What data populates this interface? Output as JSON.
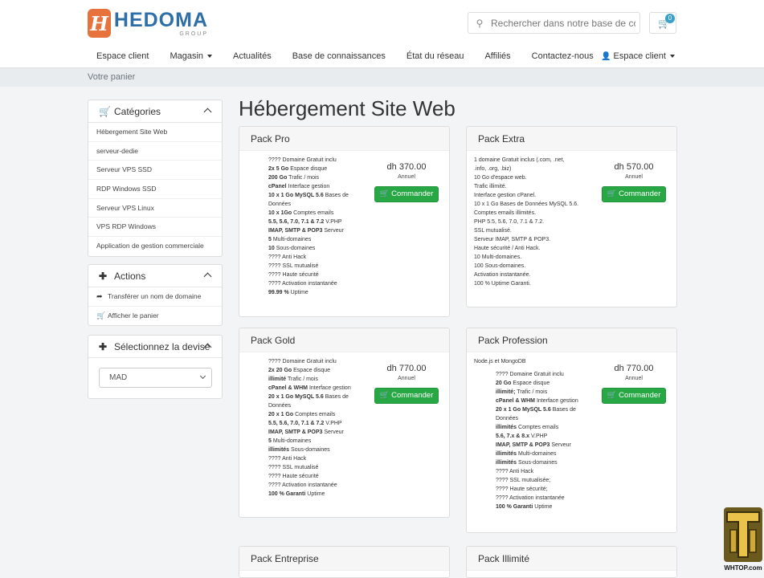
{
  "brand": {
    "badge": "H",
    "name": "HEDOMA",
    "sub": "GROUP",
    "color": "#e8723c"
  },
  "search": {
    "placeholder": "Rechercher dans notre base de connaissances"
  },
  "cart": {
    "count": "0"
  },
  "nav": {
    "items": [
      "Espace client",
      "Magasin",
      "Actualités",
      "Base de connaissances",
      "État du réseau",
      "Affiliés",
      "Contactez-nous"
    ],
    "account": "Espace client"
  },
  "breadcrumb": "Votre panier",
  "sidebar": {
    "categories": {
      "title": "Catégories",
      "items": [
        "Hébergement Site Web",
        "serveur-dedie",
        "Serveur VPS SSD",
        "RDP Windows SSD",
        "Serveur VPS Linux",
        "VPS RDP Windows",
        "Application de gestion commerciale"
      ]
    },
    "actions": {
      "title": "Actions",
      "items": [
        "Transférer un nom de domaine",
        "Afficher le panier"
      ]
    },
    "currency": {
      "title": "Sélectionnez la devise",
      "selected": "MAD"
    }
  },
  "page_title": "Hébergement Site Web",
  "products": [
    {
      "name": "Pack Pro",
      "price": "dh 370.00",
      "cycle": "Annuel",
      "button": "Commander",
      "features": [
        [
          "",
          "???? Domaine Gratuit inclu"
        ],
        [
          "2x 5 Go",
          " Espace disque"
        ],
        [
          "200 Go",
          " Trafic / mois"
        ],
        [
          "cPanel",
          " Interface gestion"
        ],
        [
          "10 x 1 Go MySQL 5.6",
          " Bases de"
        ],
        [
          "",
          "Données"
        ],
        [
          "10 x 1Go",
          " Comptes emails"
        ],
        [
          "5.5, 5.6, 7.0, 7.1 & 7.2",
          " V.PHP"
        ],
        [
          "IMAP, SMTP & POP3",
          " Serveur"
        ],
        [
          "5",
          " Multi-domaines"
        ],
        [
          "10",
          " Sous-domaines"
        ],
        [
          "",
          "???? Anti Hack"
        ],
        [
          "",
          "???? SSL mutualisé"
        ],
        [
          "",
          "???? Haute sécurité"
        ],
        [
          "",
          "???? Activation instantanée"
        ],
        [
          "99.99 %",
          " Uptime"
        ]
      ]
    },
    {
      "name": "Pack Extra",
      "price": "dh 570.00",
      "cycle": "Annuel",
      "button": "Commander",
      "lines": [
        "1 domaine Gratuit inclus (.com, .net,",
        ".info, .org, .biz)",
        "10 Go d'espace web.",
        "Trafic illimité.",
        "Interface gestion cPanel.",
        "10 x 1 Go Bases de Données MySQL 5.6.",
        "Comptes emails illimités.",
        "PHP 5.5, 5.6, 7.0, 7.1 & 7.2.",
        "SSL mutualisé.",
        "Serveur IMAP, SMTP & POP3.",
        "Haute sécurité / Anti Hack.",
        "10 Multi-domaines.",
        "100 Sous-domaines.",
        "Activation instantanée.",
        "100 % Uptime Garanti."
      ]
    },
    {
      "name": "Pack Gold",
      "price": "dh 770.00",
      "cycle": "Annuel",
      "button": "Commander",
      "features": [
        [
          "",
          "???? Domaine Gratuit inclu"
        ],
        [
          "2x 20 Go",
          " Espace disque"
        ],
        [
          "illimité",
          " Trafic / mois"
        ],
        [
          "cPanel & WHM",
          " Interface gestion"
        ],
        [
          "20 x 1 Go MySQL 5.6",
          " Bases de"
        ],
        [
          "",
          "Données"
        ],
        [
          "20 x 1 Go",
          " Comptes emails"
        ],
        [
          "5.5, 5.6, 7.0, 7.1 & 7.2",
          " V.PHP"
        ],
        [
          "IMAP, SMTP & POP3",
          " Serveur"
        ],
        [
          "5",
          " Multi-domaines"
        ],
        [
          "illimités",
          " Sous-domaines"
        ],
        [
          "",
          "???? Anti Hack"
        ],
        [
          "",
          "???? SSL mutualisé"
        ],
        [
          "",
          "???? Haute sécurité"
        ],
        [
          "",
          "???? Activation instantanée"
        ],
        [
          "100 % Garanti",
          " Uptime"
        ]
      ]
    },
    {
      "name": "Pack Profession",
      "price": "dh 770.00",
      "cycle": "Annuel",
      "button": "Commander",
      "intro": "Node.js et MongoDB",
      "features": [
        [
          "",
          "???? Domaine Gratuit inclu"
        ],
        [
          "20 Go",
          " Espace disque"
        ],
        [
          "illimité;",
          " Trafic / mois"
        ],
        [
          "cPanel & WHM",
          " Interface gestion"
        ],
        [
          "20 x 1 Go MySQL 5.6",
          " Bases de"
        ],
        [
          "",
          "Données"
        ],
        [
          "illimités",
          " Comptes emails"
        ],
        [
          "5.6, 7.x & 8.x",
          " V.PHP"
        ],
        [
          "IMAP, SMTP & POP3",
          " Serveur"
        ],
        [
          "illimités",
          " Multi-domaines"
        ],
        [
          "illimités",
          " Sous-domaines"
        ],
        [
          "",
          "???? Anti Hack"
        ],
        [
          "",
          "???? SSL mutualisée;"
        ],
        [
          "",
          "???? Haute sécurité;"
        ],
        [
          "",
          "???? Activation instantanée"
        ],
        [
          "100 % Garanti",
          " Uptime"
        ]
      ]
    },
    {
      "name": "Pack Entreprise"
    },
    {
      "name": "Pack Illimité"
    }
  ],
  "watermark": {
    "text": "WHTOP.com"
  }
}
